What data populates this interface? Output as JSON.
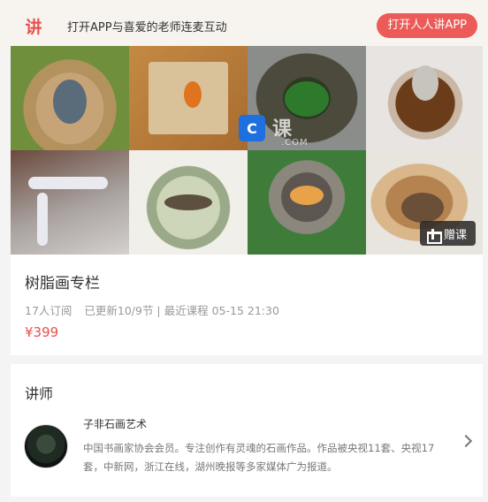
{
  "topbar": {
    "logo_glyph": "讲",
    "prompt": "打开APP与喜爱的老师连麦互动",
    "open_button": "打开人人讲APP"
  },
  "banner": {
    "gift_button": "赠课",
    "watermark": {
      "badge": "C",
      "text": "课",
      "sub": ".COM"
    }
  },
  "course": {
    "title": "树脂画专栏",
    "subscribers": "17人订阅",
    "updates": "已更新10/9节 | 最近课程 05-15 21:30",
    "price": "¥399"
  },
  "teacher": {
    "heading": "讲师",
    "name": "子非石画艺术",
    "description": "中国书画家协会会员。专注创作有灵魂的石画作品。作品被央视11套、央视17套，中新网，浙江在线，湖州晚报等多家媒体广为报道。"
  },
  "colors": {
    "accent": "#ec5b57",
    "price": "#e8504d",
    "background": "#f4f4f4"
  },
  "icons": {
    "gift": "gift-icon",
    "chevron": "chevron-right-icon",
    "logo": "logo-icon"
  }
}
